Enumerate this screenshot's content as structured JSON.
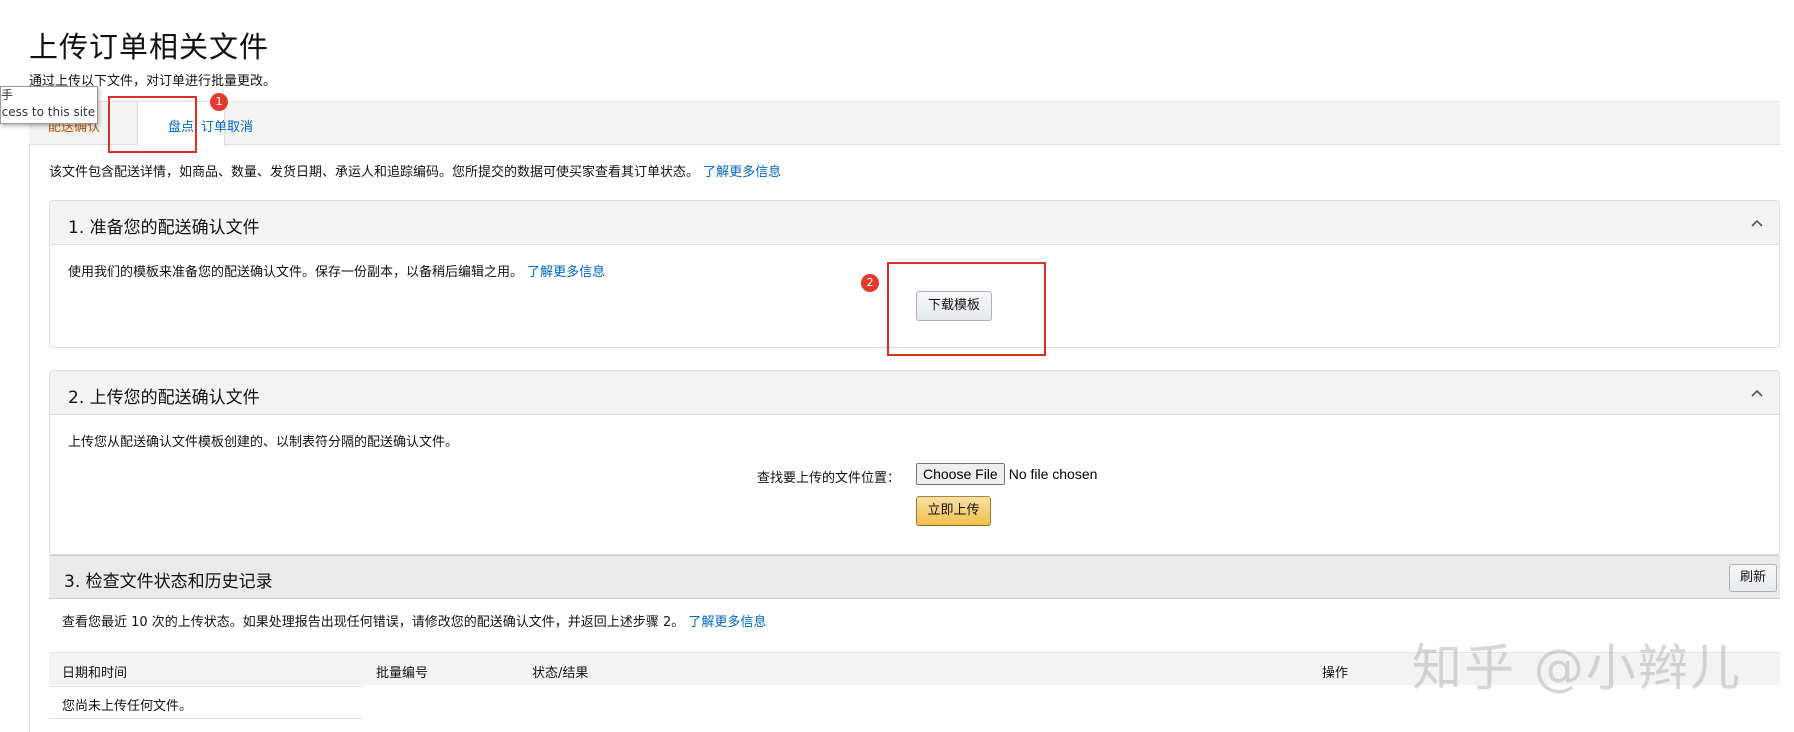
{
  "page": {
    "title": "上传订单相关文件",
    "subtitle": "通过上传以下文件，对订单进行批量更改。"
  },
  "tooltip": {
    "line1": "手",
    "line2": "ccess to this site"
  },
  "tabs": [
    {
      "label": "配送确认",
      "active": false
    },
    {
      "label": "盘点",
      "active": true
    },
    {
      "label": "订单取消",
      "active": false
    }
  ],
  "annotations": {
    "badge1": "1",
    "badge2": "2",
    "color": "#d9302b"
  },
  "intro": {
    "text": "该文件包含配送详情，如商品、数量、发货日期、承运人和追踪编码。您所提交的数据可使买家查看其订单状态。",
    "link": "了解更多信息"
  },
  "section1": {
    "title": "1. 准备您的配送确认文件",
    "text": "使用我们的模板来准备您的配送确认文件。保存一份副本，以备稍后编辑之用。",
    "link": "了解更多信息",
    "download_label": "下载模板",
    "collapse_icon": "chevron-up-icon"
  },
  "section2": {
    "title": "2. 上传您的配送确认文件",
    "text": "上传您从配送确认文件模板创建的、以制表符分隔的配送确认文件。",
    "find_label": "查找要上传的文件位置：",
    "choose_file_label": "Choose File",
    "no_file_label": "No file chosen",
    "upload_label": "立即上传",
    "collapse_icon": "chevron-up-icon"
  },
  "section3": {
    "title": "3. 检查文件状态和历史记录",
    "refresh_label": "刷新",
    "text": "查看您最近 10 次的上传状态。如果处理报告出现任何错误，请修改您的配送确认文件，并返回上述步骤 2。",
    "link": "了解更多信息",
    "columns": [
      "日期和时间",
      "批量编号",
      "状态/结果",
      "操作"
    ],
    "empty_text": "您尚未上传任何文件。"
  },
  "watermark": "知乎 @小辫儿",
  "colors": {
    "link": "#0066c0",
    "tab_inactive": "#c45500",
    "upload_button": "#f0c14b"
  }
}
